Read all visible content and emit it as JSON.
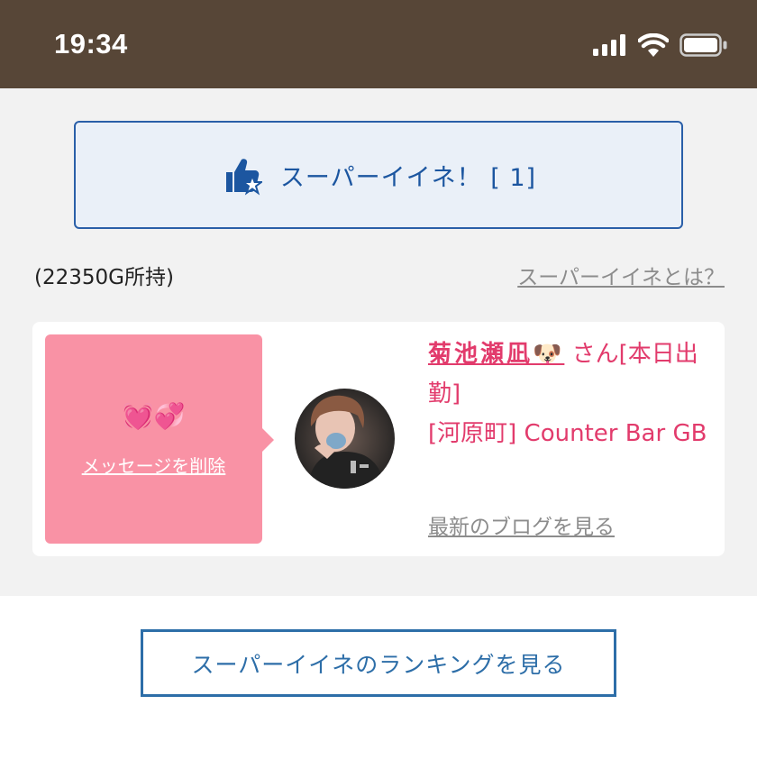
{
  "status_bar": {
    "time": "19:34",
    "icons": [
      "signal-icon",
      "wifi-icon",
      "battery-icon"
    ]
  },
  "super_like": {
    "label": "スーパーイイネ！ [ 1]",
    "icon": "thumbs-up-star-icon"
  },
  "balance": {
    "text": "(22350G所持)"
  },
  "help_link": {
    "text": "スーパーイイネとは？"
  },
  "card": {
    "message_emojis": "💓💞",
    "delete_message_label": "メッセージを削除",
    "cast_name": "菊池瀬凪🐶",
    "cast_suffix": " さん[本日出勤]",
    "shop": "[河原町] Counter Bar GB",
    "latest_blog_label": "最新のブログを見る"
  },
  "ranking_button": {
    "label": "スーパーイイネのランキングを見る"
  },
  "colors": {
    "status_bar_bg": "#574637",
    "accent_blue": "#1c56a0",
    "pink": "#f992a5",
    "cast_text": "#e23b6c"
  }
}
